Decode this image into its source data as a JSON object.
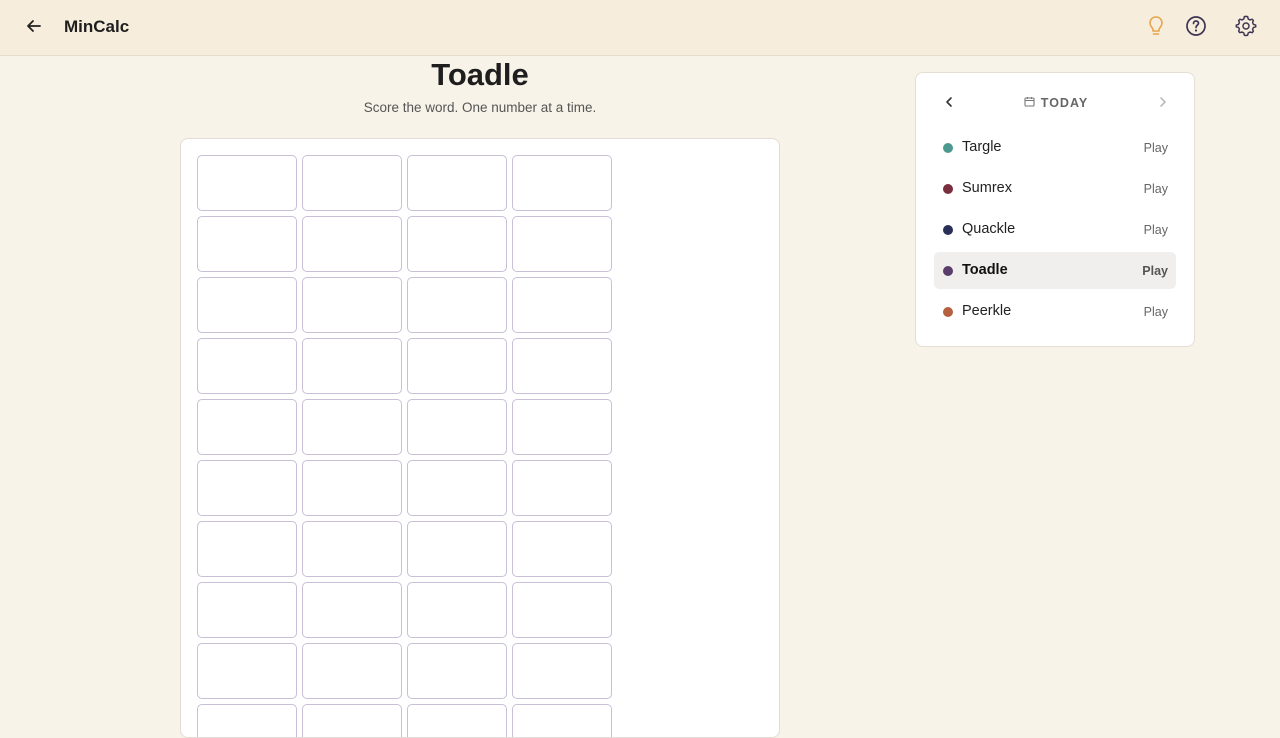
{
  "header": {
    "app_title": "MinCalc",
    "icons": {
      "back": "arrow-left-icon",
      "hint": "lightbulb-icon",
      "help": "help-circle-icon",
      "settings": "gear-icon"
    },
    "colors": {
      "hint": "#e5a54b",
      "help": "#3d3553",
      "settings": "#3d3553"
    }
  },
  "game": {
    "title": "Toadle",
    "subtitle": "Score the word. One number at a time.",
    "grid": {
      "columns": 4,
      "visible_rows": 10,
      "values": []
    }
  },
  "panel": {
    "date_label": "TODAY",
    "icons": {
      "prev": "chevron-left-icon",
      "next": "chevron-right-icon",
      "calendar": "calendar-icon"
    },
    "games": [
      {
        "name": "Targle",
        "action": "Play",
        "color": "#4c9a8f",
        "active": false
      },
      {
        "name": "Sumrex",
        "action": "Play",
        "color": "#7a2d3c",
        "active": false
      },
      {
        "name": "Quackle",
        "action": "Play",
        "color": "#2a2f57",
        "active": false
      },
      {
        "name": "Toadle",
        "action": "Play",
        "color": "#5a3d6b",
        "active": true
      },
      {
        "name": "Peerkle",
        "action": "Play",
        "color": "#b5603f",
        "active": false
      }
    ]
  }
}
